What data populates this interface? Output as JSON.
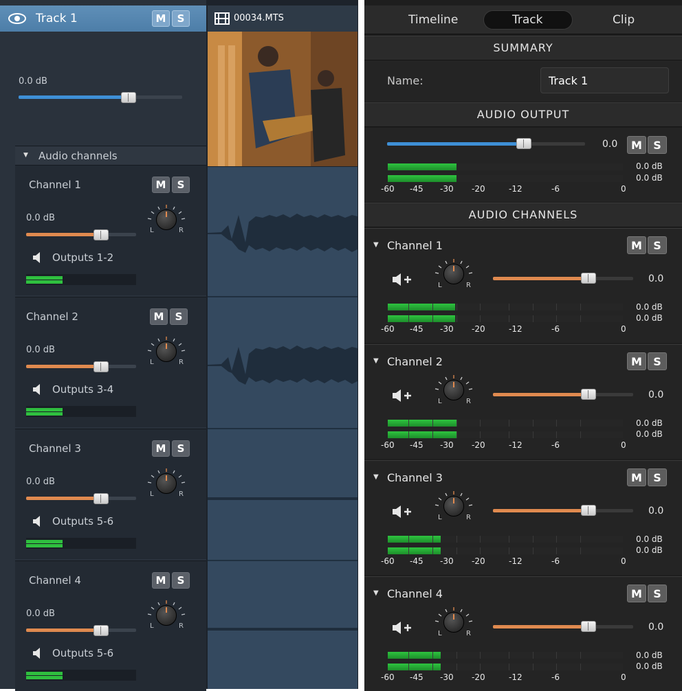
{
  "left": {
    "track_title": "Track 1",
    "mute": "M",
    "solo": "S",
    "track_volume": "0.0 dB",
    "audio_channels_label": "Audio channels",
    "clip_name": "00034.MTS",
    "channels": [
      {
        "name": "Channel 1",
        "volume": "0.0 dB",
        "outputs": "Outputs 1-2",
        "pan_l": "L",
        "pan_r": "R"
      },
      {
        "name": "Channel 2",
        "volume": "0.0 dB",
        "outputs": "Outputs 3-4",
        "pan_l": "L",
        "pan_r": "R"
      },
      {
        "name": "Channel 3",
        "volume": "0.0 dB",
        "outputs": "Outputs 5-6",
        "pan_l": "L",
        "pan_r": "R"
      },
      {
        "name": "Channel 4",
        "volume": "0.0 dB",
        "outputs": "Outputs 5-6",
        "pan_l": "L",
        "pan_r": "R"
      }
    ]
  },
  "right": {
    "tabs": [
      "Timeline",
      "Track",
      "Clip"
    ],
    "selected_tab": "Track",
    "summary_header": "SUMMARY",
    "name_label": "Name:",
    "name_value": "Track 1",
    "audio_output_header": "AUDIO OUTPUT",
    "output_value": "0.0",
    "mute": "M",
    "solo": "S",
    "meter_db_1": "0.0 dB",
    "meter_db_2": "0.0 dB",
    "scale": [
      "-60",
      "-45",
      "-30",
      "-20",
      "-12",
      "-6",
      "0"
    ],
    "audio_channels_header": "AUDIO CHANNELS",
    "channels": [
      {
        "name": "Channel 1",
        "value": "0.0",
        "db1": "0.0 dB",
        "db2": "0.0 dB",
        "pan_l": "L",
        "pan_r": "R"
      },
      {
        "name": "Channel 2",
        "value": "0.0",
        "db1": "0.0 dB",
        "db2": "0.0 dB",
        "pan_l": "L",
        "pan_r": "R"
      },
      {
        "name": "Channel 3",
        "value": "0.0",
        "db1": "0.0 dB",
        "db2": "0.0 dB",
        "pan_l": "L",
        "pan_r": "R"
      },
      {
        "name": "Channel 4",
        "value": "0.0",
        "db1": "0.0 dB",
        "db2": "0.0 dB",
        "pan_l": "L",
        "pan_r": "R"
      }
    ]
  },
  "colors": {
    "track_blue": "#4d7ea8",
    "volume_blue": "#3e8fd6",
    "channel_orange": "#e08a4f",
    "meter_green": "#2fbf3f"
  }
}
